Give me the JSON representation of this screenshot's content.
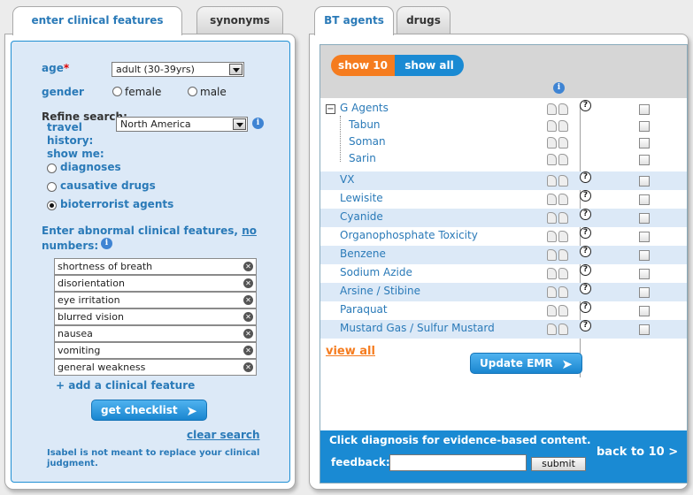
{
  "left_tabs": {
    "active": "enter clinical features",
    "inactive": "synonyms"
  },
  "form": {
    "age_label": "age",
    "age_value": "adult (30-39yrs)",
    "gender_label": "gender",
    "gender_female": "female",
    "gender_male": "male",
    "refine_label": "Refine search:",
    "travel_label_1": "travel",
    "travel_label_2": "history:",
    "travel_value": "North America",
    "show_me_label": "show me:",
    "opt_diagnoses": "diagnoses",
    "opt_causative": "causative drugs",
    "opt_bioterrorist": "bioterrorist agents",
    "enter_abnormal": "Enter abnormal clinical features,",
    "no_link": "no",
    "numbers_label": "numbers:",
    "features": [
      "shortness of breath",
      "disorientation",
      "eye irritation",
      "blurred vision",
      "nausea",
      "vomiting",
      "general weakness"
    ],
    "add_feature": "+ add a clinical feature",
    "get_checklist": "get checklist",
    "clear_search": "clear search",
    "disclaimer": "Isabel is not meant to replace your clinical judgment."
  },
  "right_tabs": {
    "active": "BT agents",
    "inactive": "drugs"
  },
  "results": {
    "show10": "show 10",
    "show_all": "show all",
    "group_toggle": "−",
    "group_name": "G Agents",
    "sub_agents": [
      "Tabun",
      "Soman",
      "Sarin"
    ],
    "agents": [
      "VX",
      "Lewisite",
      "Cyanide",
      "Organophosphate Toxicity",
      "Benzene",
      "Sodium Azide",
      "Arsine / Stibine",
      "Paraquat",
      "Mustard Gas / Sulfur Mustard"
    ],
    "view_all": "view all",
    "update_emr": "Update EMR",
    "footer_click": "Click diagnosis for evidence-based content.",
    "feedback_label": "feedback:",
    "submit": "submit",
    "back": "back to 10 >"
  },
  "colors": {
    "brand_blue": "#1a8ad3",
    "accent_orange": "#f57c1f",
    "label_blue": "#2a7ab8",
    "row_alt": "#dce9f7"
  }
}
